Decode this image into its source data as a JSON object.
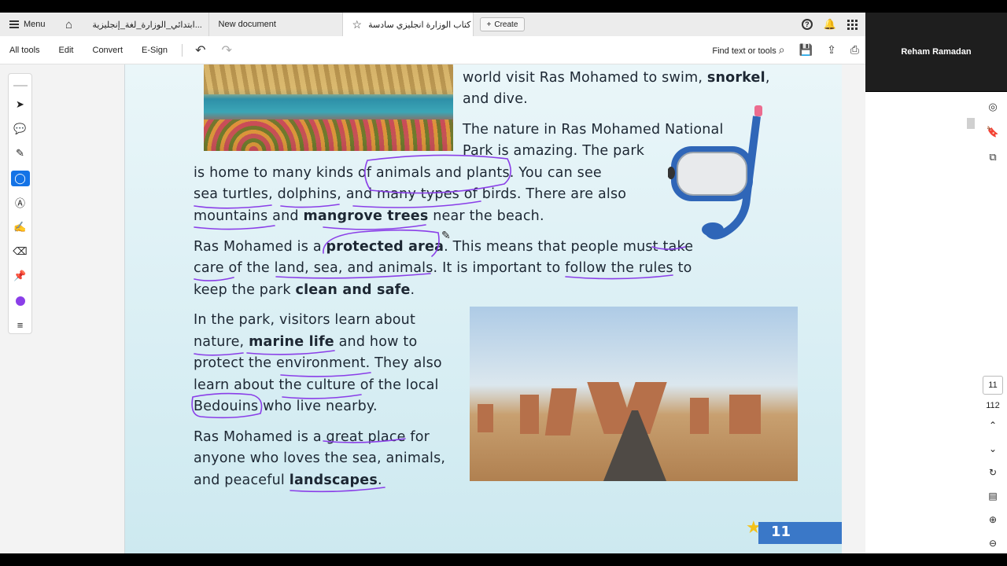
{
  "tabs": {
    "menu_label": "Menu",
    "items": [
      {
        "label": "ابتدائي_الوزارة_لغة_إنجليزية..."
      },
      {
        "label": "New document"
      },
      {
        "label": "كتاب الوزارة انجليزي سادسة .."
      }
    ],
    "create_label": "Create"
  },
  "toolbar": {
    "all_tools": "All tools",
    "edit": "Edit",
    "convert": "Convert",
    "esign": "E-Sign",
    "find": "Find text or tools"
  },
  "tools": [
    "select-tool",
    "comment-tool",
    "highlight-tool",
    "draw-tool",
    "text-select-tool",
    "fill-sign-tool",
    "eraser-tool",
    "pin-tool",
    "color-tool",
    "menu-tool"
  ],
  "active_tool": "draw-tool",
  "annotation_color": "#8a3ee8",
  "document": {
    "lines": [
      {
        "text": "world visit Ras Mohamed to swim, ",
        "bold": "snorkel",
        "tail": ","
      },
      {
        "text": "and dive."
      },
      {
        "text": "The nature in Ras Mohamed National"
      },
      {
        "text": "Park is amazing. The park"
      },
      {
        "text": "is home to many kinds of animals and plants. You can see"
      },
      {
        "text": "sea turtles, dolphins, and many types of birds. There are also"
      },
      {
        "pre": "mountains and ",
        "bold": "mangrove trees",
        "tail": " near the beach."
      },
      {
        "pre": "Ras Mohamed is a ",
        "bold": "protected area",
        "tail": ". This means that people must take"
      },
      {
        "text": "care of the land, sea, and animals. It is important to follow the rules to"
      },
      {
        "pre": "keep the park ",
        "bold": "clean and safe",
        "tail": "."
      },
      {
        "text": "In the park, visitors learn about"
      },
      {
        "pre": "nature, ",
        "bold": "marine life",
        "tail": " and how to"
      },
      {
        "text": "protect the environment. They also"
      },
      {
        "text": "learn about the culture of the local"
      },
      {
        "text": "Bedouins who live nearby."
      },
      {
        "text": "Ras Mohamed is a great place for"
      },
      {
        "text": "anyone who loves the sea, animals,"
      },
      {
        "pre": "and peaceful ",
        "bold": "landscapes",
        "tail": "."
      }
    ],
    "page_badge": "11"
  },
  "page_nav": {
    "current": "11",
    "total": "112"
  },
  "video": {
    "name": "Reham Ramadan"
  }
}
